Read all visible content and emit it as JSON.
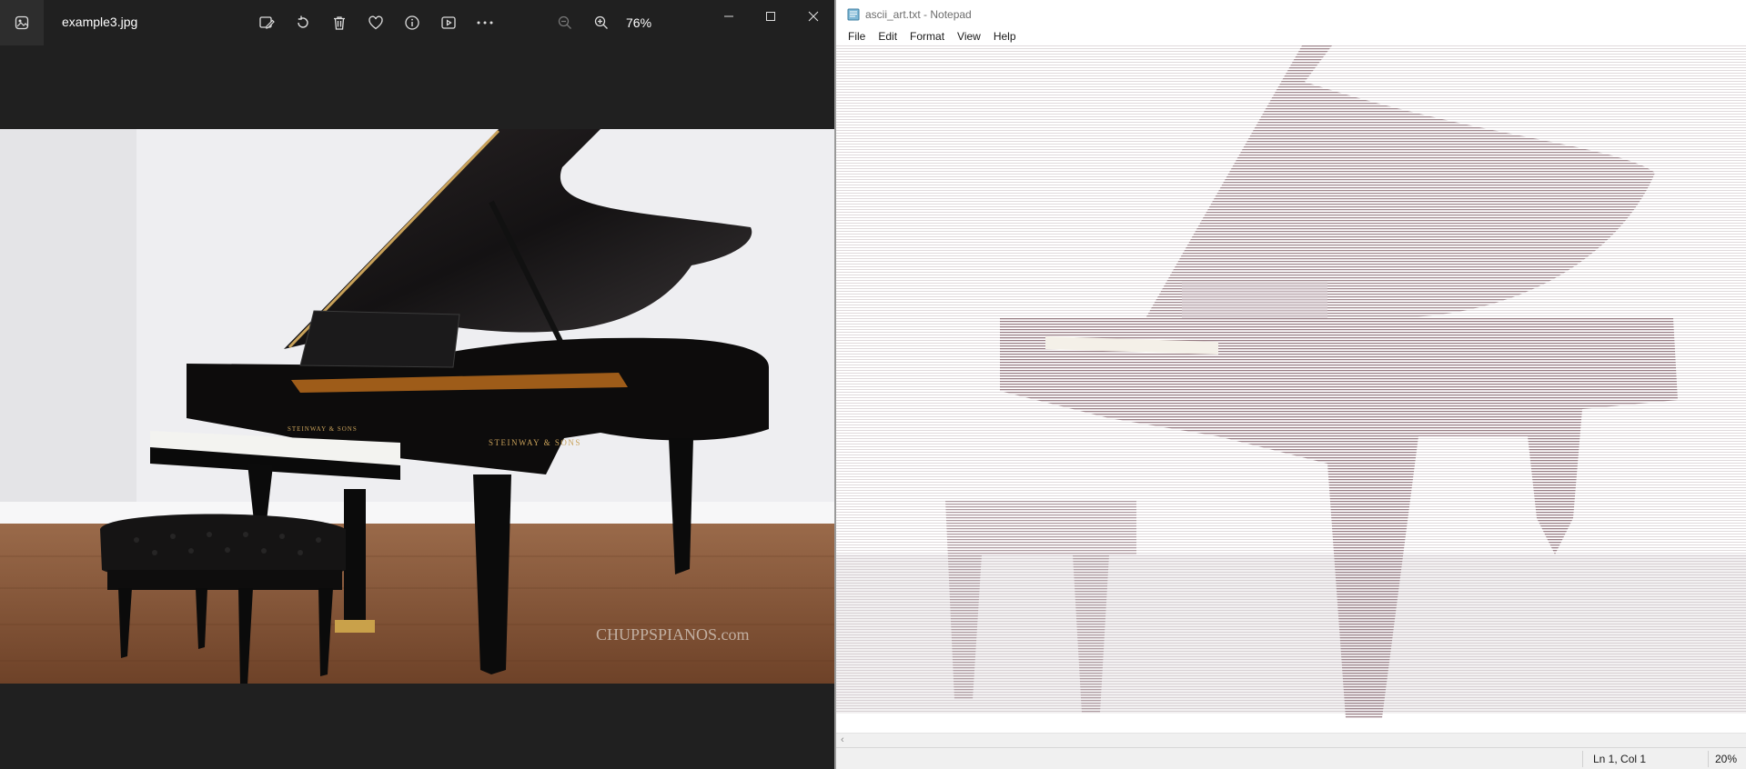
{
  "photos": {
    "filename": "example3.jpg",
    "zoom_level": "76%",
    "toolbar": [
      {
        "icon": "edit-image-icon"
      },
      {
        "icon": "rotate-icon"
      },
      {
        "icon": "delete-icon"
      },
      {
        "icon": "favorite-heart-icon"
      },
      {
        "icon": "info-icon"
      },
      {
        "icon": "slideshow-icon"
      },
      {
        "icon": "more-icon"
      },
      {
        "icon": "zoom-out-icon"
      },
      {
        "icon": "zoom-in-icon"
      }
    ],
    "photo": {
      "fallboard_brand": "STEINWAY & SONS",
      "case_brand": "STEINWAY & SONS",
      "watermark": "CHUPPSPIANOS.com"
    }
  },
  "notepad": {
    "title": "ascii_art.txt - Notepad",
    "menu": [
      "File",
      "Edit",
      "Format",
      "View",
      "Help"
    ],
    "status_position": "Ln 1, Col 1",
    "status_zoom": "20%"
  },
  "colors": {
    "photos_bg": "#202020",
    "ascii_tint": "#9b7a82",
    "floor": "#8a5a3c"
  }
}
